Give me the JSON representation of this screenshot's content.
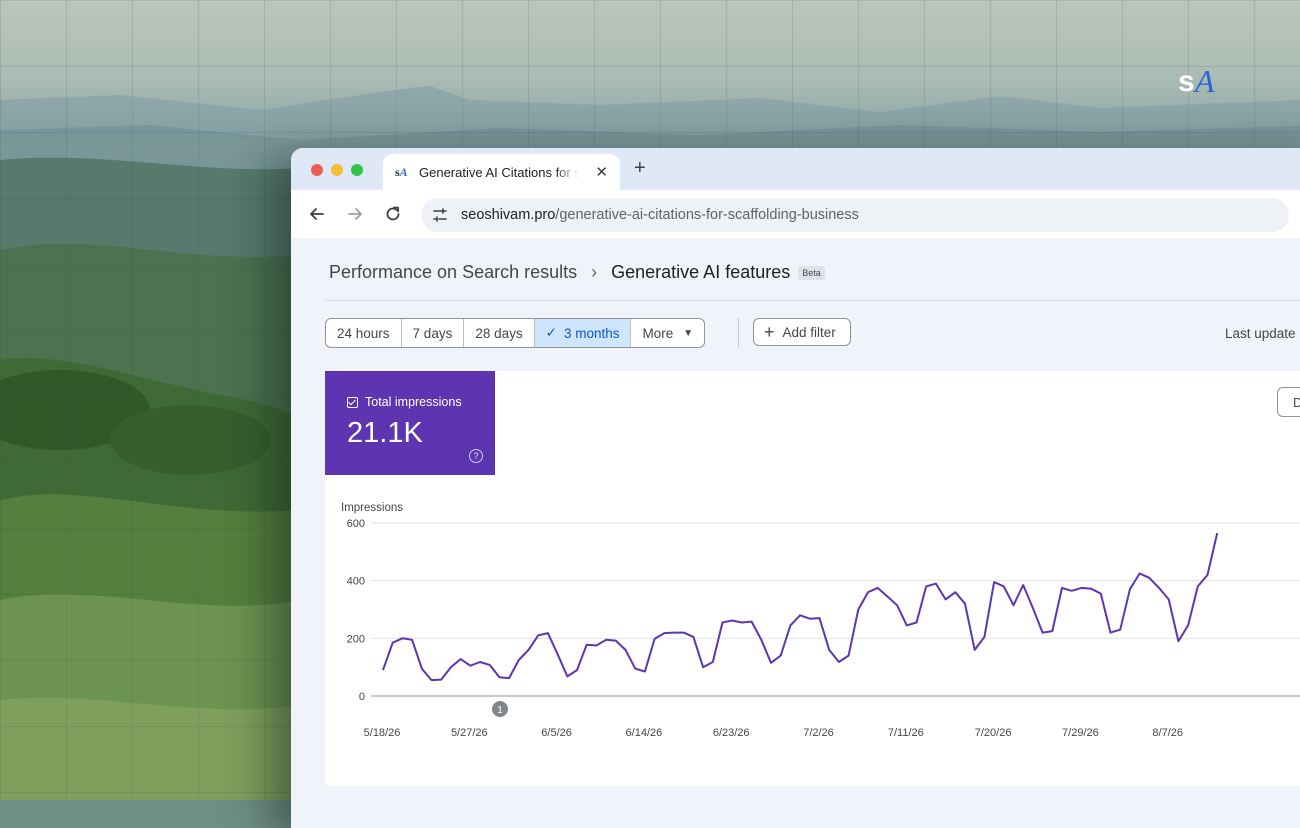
{
  "browser": {
    "tab_title": "Generative AI Citations for scaffolding business",
    "url_domain": "seoshivam.pro",
    "url_path": "/generative-ai-citations-for-scaffolding-business"
  },
  "breadcrumb": {
    "parent": "Performance on Search results",
    "current": "Generative AI features",
    "badge": "Beta"
  },
  "date_ranges": [
    "24 hours",
    "7 days",
    "28 days",
    "3 months",
    "More"
  ],
  "active_range": "3 months",
  "filter_button": "Add filter",
  "last_update": "Last update",
  "download_label": "D",
  "metric": {
    "label": "Total impressions",
    "value": "21.1K",
    "help": "?"
  },
  "annotation": "1",
  "colors": {
    "metric_bg": "#5e35b1",
    "line": "#5e35b1",
    "active_range": "#cfe5fb"
  },
  "chart_data": {
    "type": "line",
    "ylabel": "Impressions",
    "ylim": [
      0,
      600
    ],
    "yticks": [
      0,
      200,
      400,
      600
    ],
    "x_ticks": [
      "5/18/26",
      "5/27/26",
      "6/5/26",
      "6/14/26",
      "6/23/26",
      "7/2/26",
      "7/11/26",
      "7/20/26",
      "7/29/26",
      "8/7/26"
    ],
    "grid": true,
    "x": [
      "5/18/26",
      "5/19/26",
      "5/20/26",
      "5/21/26",
      "5/22/26",
      "5/23/26",
      "5/24/26",
      "5/25/26",
      "5/26/26",
      "5/27/26",
      "5/28/26",
      "5/29/26",
      "5/30/26",
      "5/31/26",
      "6/1/26",
      "6/2/26",
      "6/3/26",
      "6/4/26",
      "6/5/26",
      "6/6/26",
      "6/7/26",
      "6/8/26",
      "6/9/26",
      "6/10/26",
      "6/11/26",
      "6/12/26",
      "6/13/26",
      "6/14/26",
      "6/15/26",
      "6/16/26",
      "6/17/26",
      "6/18/26",
      "6/19/26",
      "6/20/26",
      "6/21/26",
      "6/22/26",
      "6/23/26",
      "6/24/26",
      "6/25/26",
      "6/26/26",
      "6/27/26",
      "6/28/26",
      "6/29/26",
      "6/30/26",
      "7/1/26",
      "7/2/26",
      "7/3/26",
      "7/4/26",
      "7/5/26",
      "7/6/26",
      "7/7/26",
      "7/8/26",
      "7/9/26",
      "7/10/26",
      "7/11/26",
      "7/12/26",
      "7/13/26",
      "7/14/26",
      "7/15/26",
      "7/16/26",
      "7/17/26",
      "7/18/26",
      "7/19/26",
      "7/20/26",
      "7/21/26",
      "7/22/26",
      "7/23/26",
      "7/24/26",
      "7/25/26",
      "7/26/26",
      "7/27/26",
      "7/28/26",
      "7/29/26",
      "7/30/26",
      "7/31/26",
      "8/1/26",
      "8/2/26",
      "8/3/26",
      "8/4/26",
      "8/5/26",
      "8/6/26",
      "8/7/26",
      "8/8/26",
      "8/9/26",
      "8/10/26",
      "8/11/26"
    ],
    "series": [
      {
        "values": [
          90,
          185,
          200,
          195,
          95,
          55,
          57,
          100,
          128,
          105,
          118,
          108,
          65,
          62,
          125,
          160,
          210,
          218,
          145,
          68,
          90,
          178,
          175,
          195,
          192,
          160,
          95,
          85,
          198,
          218,
          220,
          220,
          205,
          100,
          118,
          255,
          262,
          255,
          258,
          195,
          115,
          140,
          245,
          280,
          268,
          270,
          160,
          118,
          140,
          300,
          360,
          375,
          345,
          315,
          245,
          255,
          380,
          390,
          335,
          360,
          320,
          160,
          205,
          395,
          380,
          315,
          385,
          305,
          220,
          225,
          375,
          365,
          375,
          372,
          355,
          220,
          230,
          370,
          425,
          410,
          375,
          335,
          190,
          245,
          380,
          420,
          565
        ]
      }
    ]
  }
}
